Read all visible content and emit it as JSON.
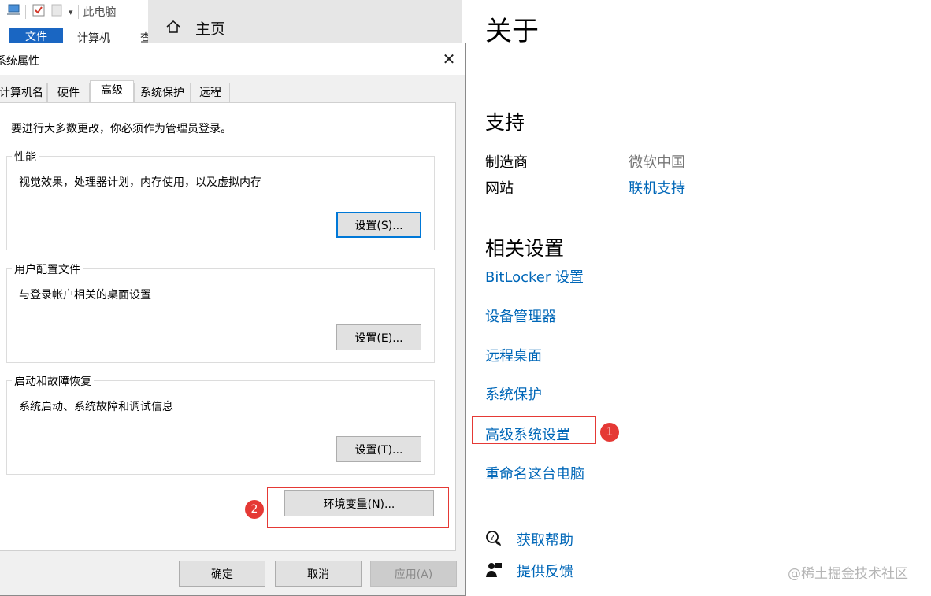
{
  "explorer": {
    "breadcrumb": "此电脑",
    "qat_dropdown": "▾",
    "ribbon_tabs": [
      "文件",
      "计算机",
      "查"
    ]
  },
  "settings_nav": {
    "home_label": "主页"
  },
  "about": {
    "title": "关于",
    "support_heading": "支持",
    "manufacturer_label": "制造商",
    "manufacturer_value": "微软中国",
    "website_label": "网站",
    "website_value": "联机支持",
    "related_heading": "相关设置",
    "related_links": [
      "BitLocker 设置",
      "设备管理器",
      "远程桌面",
      "系统保护",
      "高级系统设置",
      "重命名这台电脑"
    ],
    "help_label": "获取帮助",
    "feedback_label": "提供反馈",
    "badge_1": "1"
  },
  "watermark": "@稀土掘金技术社区",
  "dialog": {
    "title": "系统属性",
    "close_glyph": "✕",
    "tabs": [
      "计算机名",
      "硬件",
      "高级",
      "系统保护",
      "远程"
    ],
    "active_tab": "高级",
    "intro": "要进行大多数更改，你必须作为管理员登录。",
    "performance": {
      "legend": "性能",
      "desc": "视觉效果，处理器计划，内存使用，以及虚拟内存",
      "button": "设置(S)..."
    },
    "profiles": {
      "legend": "用户配置文件",
      "desc": "与登录帐户相关的桌面设置",
      "button": "设置(E)..."
    },
    "startup": {
      "legend": "启动和故障恢复",
      "desc": "系统启动、系统故障和调试信息",
      "button": "设置(T)..."
    },
    "env_button": "环境变量(N)...",
    "badge_2": "2",
    "ok": "确定",
    "cancel": "取消",
    "apply": "应用(A)"
  },
  "colors": {
    "link": "#0067b8",
    "highlight": "#e53935",
    "file_tab": "#1a66c2"
  },
  "icons": [
    "computer-icon",
    "checkbox-icon",
    "document-icon",
    "home-icon",
    "help-chat-icon",
    "feedback-icon",
    "close-icon"
  ]
}
